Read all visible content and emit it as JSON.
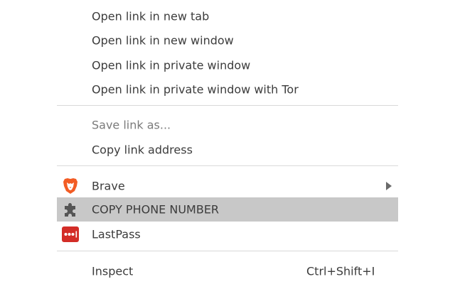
{
  "context_menu": {
    "items": [
      {
        "label": "Open link in new tab"
      },
      {
        "label": "Open link in new window"
      },
      {
        "label": "Open link in private window"
      },
      {
        "label": "Open link in private window with Tor"
      },
      {
        "label": "Save link as..."
      },
      {
        "label": "Copy link address"
      },
      {
        "label": "Brave",
        "icon": "brave-lion-icon"
      },
      {
        "label": "COPY PHONE NUMBER",
        "icon": "puzzle-extension-icon"
      },
      {
        "label": "LastPass",
        "icon": "lastpass-icon"
      },
      {
        "label": "Inspect",
        "shortcut": "Ctrl+Shift+I"
      }
    ]
  },
  "colors": {
    "highlight": "#c8c8c8",
    "brave_orange": "#f25c24",
    "lastpass_red": "#d32d27",
    "puzzle_gray": "#555555"
  }
}
